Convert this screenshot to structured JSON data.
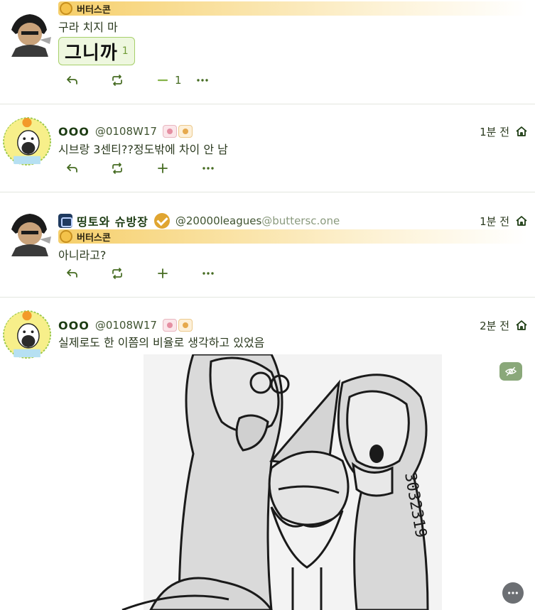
{
  "notes": [
    {
      "instance": "버터스콘",
      "text": "구라 치지 마",
      "reaction": {
        "emoji": "그니까",
        "count": "1"
      },
      "actions": {
        "reply": "reply-icon",
        "renote": "renote-icon",
        "react": "minus-icon",
        "react_count": "1",
        "more": "more-icon"
      }
    },
    {
      "name": "OOO",
      "acct": "@0108W17",
      "time": "1분 전",
      "text": "시브랑 3센티??정도밖에 차이 안 남"
    },
    {
      "name": "띵토와 슈방장",
      "acct": "@20000leagues",
      "acct_host": "@buttersc.one",
      "instance": "버터스콘",
      "time": "1분 전",
      "text": "아니라고?"
    },
    {
      "name": "OOO",
      "acct": "@0108W17",
      "time": "2분 전",
      "text": "실제로도 한 이쯤의 비율로 생각하고 있었음",
      "media": {
        "handwritten": "3032319",
        "sensitive_toggle": "eye-off-icon"
      }
    }
  ],
  "colors": {
    "accent": "#86b34a",
    "text": "#2b3a1f",
    "instance_gradient": "#f6cf6b",
    "hide_button": "#8aa87a"
  }
}
